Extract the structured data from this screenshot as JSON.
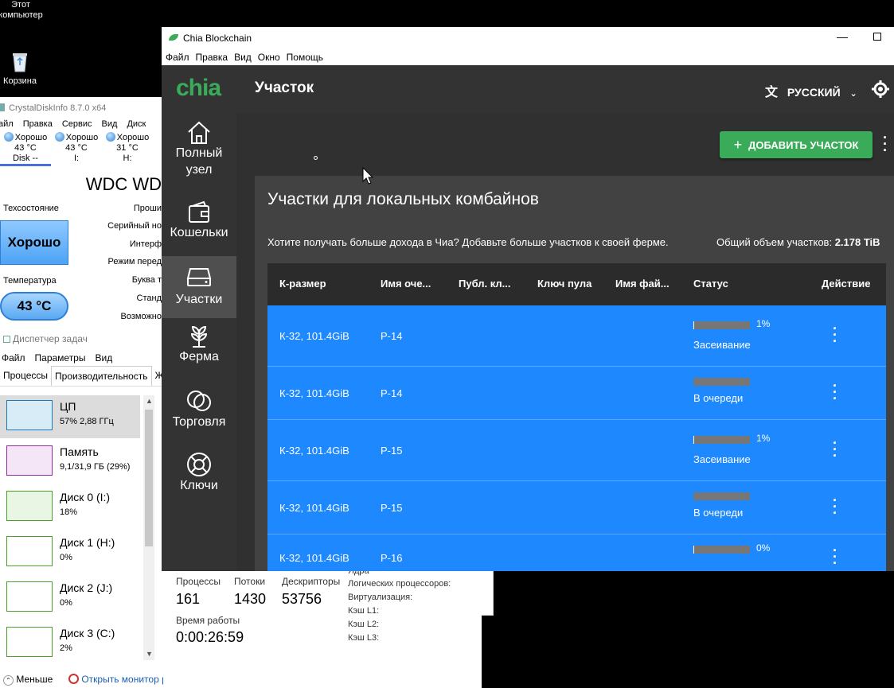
{
  "desktop": {
    "icons": [
      {
        "label_line1": "Этот",
        "label_line2": "компьютер",
        "icon": "computer-icon"
      },
      {
        "label": "Корзина",
        "icon": "recycle-bin-icon"
      }
    ]
  },
  "crystaldisk": {
    "title": "CrystalDiskInfo 8.7.0 x64",
    "menu": [
      "айл",
      "Правка",
      "Сервис",
      "Вид",
      "Диск"
    ],
    "disks": [
      {
        "status": "Хорошо",
        "temp": "43 °C",
        "drive": "Disk --"
      },
      {
        "status": "Хорошо",
        "temp": "43 °C",
        "drive": "I:"
      },
      {
        "status": "Хорошо",
        "temp": "31 °C",
        "drive": "H:"
      }
    ],
    "model": "WDC WD",
    "health_label": "Техсостояние",
    "health_value": "Хорошо",
    "temp_label": "Температура",
    "temp_value": "43 °C",
    "right_labels": [
      "Проши",
      "Серийный но",
      "Интерф",
      "Режим перед",
      "Буква т",
      "Станд",
      "Возможно"
    ]
  },
  "taskmgr": {
    "title": "Диспетчер задач",
    "menu": [
      "Файл",
      "Параметры",
      "Вид"
    ],
    "tabs": [
      "Процессы",
      "Производительность",
      "Жу"
    ],
    "items": [
      {
        "name": "ЦП",
        "sub": "57% 2,88 ГГц",
        "color": "#1a7ab8",
        "fill": "#d8ecf8"
      },
      {
        "name": "Память",
        "sub": "9,1/31,9 ГБ (29%)",
        "color": "#8b2fa0",
        "fill": "#f4e6f7"
      },
      {
        "name": "Диск 0 (I:)",
        "sub": "18%",
        "color": "#4aa02c",
        "fill": "#eaf6e4"
      },
      {
        "name": "Диск 1 (H:)",
        "sub": "0%",
        "color": "#4aa02c",
        "fill": "#ffffff"
      },
      {
        "name": "Диск 2 (J:)",
        "sub": "0%",
        "color": "#4aa02c",
        "fill": "#ffffff"
      },
      {
        "name": "Диск 3 (C:)",
        "sub": "2%",
        "color": "#4aa02c",
        "fill": "#ffffff"
      }
    ],
    "footer": {
      "less": "Меньше",
      "monitor": "Открыть монитор ресурсов"
    },
    "stats": {
      "processes_label": "Процессы",
      "processes": "161",
      "threads_label": "Потоки",
      "threads": "1430",
      "handles_label": "Дескрипторы",
      "handles": "53756",
      "uptime_label": "Время работы",
      "uptime": "0:00:26:59",
      "right": [
        "Ядра",
        "Логических процессоров:",
        "Виртуализация:",
        "Кэш L1:",
        "Кэш L2:",
        "Кэш L3:"
      ]
    }
  },
  "chia": {
    "window_title": "Chia Blockchain",
    "menu": [
      "Файл",
      "Правка",
      "Вид",
      "Окно",
      "Помощь"
    ],
    "logo": "chia",
    "page_title": "Участок",
    "language": "РУССКИЙ",
    "nav": [
      {
        "label_line1": "Полный",
        "label_line2": "узел",
        "icon": "home-icon"
      },
      {
        "label": "Кошельки",
        "icon": "wallet-icon"
      },
      {
        "label": "Участки",
        "icon": "hard-drive-icon",
        "active": true
      },
      {
        "label": "Ферма",
        "icon": "plant-icon"
      },
      {
        "label": "Торговля",
        "icon": "trade-icon"
      },
      {
        "label": "Ключи",
        "icon": "lifebuoy-icon"
      }
    ],
    "add_button": "ДОБАВИТЬ УЧАСТОК",
    "card_title": "Участки для локальных комбайнов",
    "card_subtitle": "Хотите получать больше дохода в Чиа? Добавьте больше участков к своей ферме.",
    "total_label": "Общий объем участков:",
    "total_value": "2.178 TiB",
    "columns": [
      "К-размер",
      "Имя оче...",
      "Публ. кл...",
      "Ключ пула",
      "Имя фай...",
      "Статус",
      "Действие"
    ],
    "rows": [
      {
        "size": "К-32, 101.4GiB",
        "queue": "P-14",
        "progress": 0.01,
        "percent": "1%",
        "status": "Засеивание"
      },
      {
        "size": "К-32, 101.4GiB",
        "queue": "P-14",
        "progress": 0,
        "percent": "",
        "status": "В очереди"
      },
      {
        "size": "К-32, 101.4GiB",
        "queue": "P-15",
        "progress": 0.01,
        "percent": "1%",
        "status": "Засеивание"
      },
      {
        "size": "К-32, 101.4GiB",
        "queue": "P-15",
        "progress": 0,
        "percent": "",
        "status": "В очереди"
      },
      {
        "size": "К-32, 101.4GiB",
        "queue": "P-16",
        "progress": 0,
        "percent": "0%",
        "status": ""
      }
    ]
  }
}
